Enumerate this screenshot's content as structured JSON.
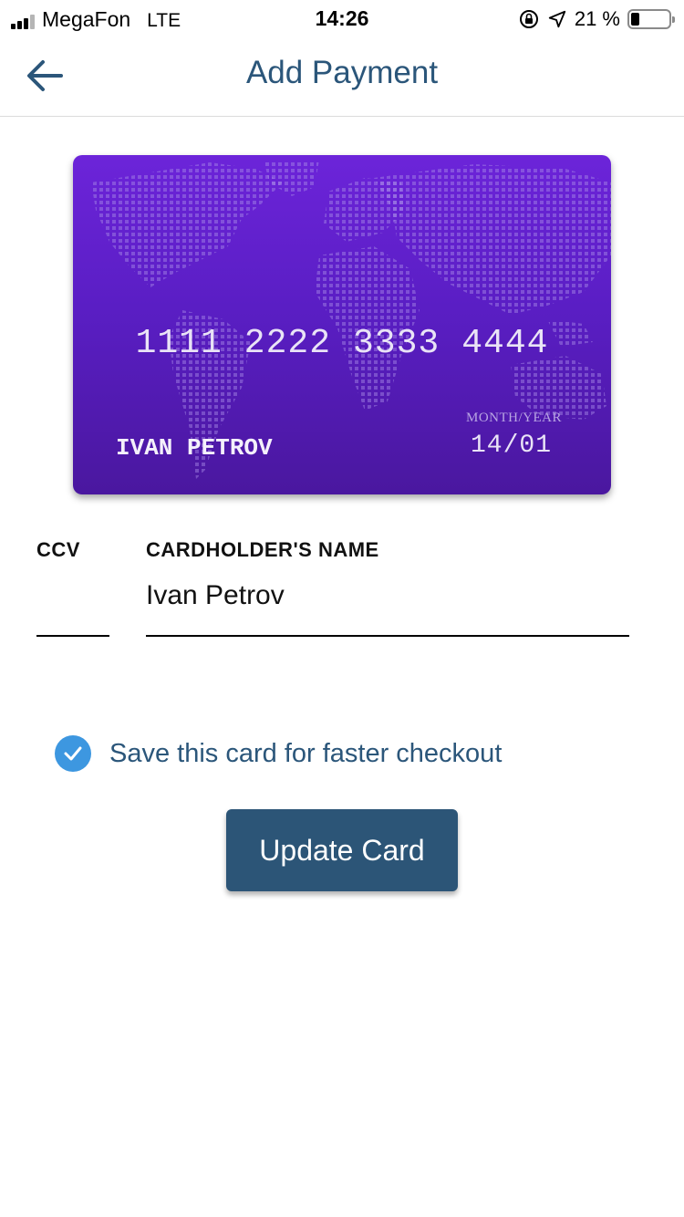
{
  "status_bar": {
    "carrier": "MegaFon",
    "network": "LTE",
    "time": "14:26",
    "battery": "21 %",
    "battery_level": 0.21
  },
  "header": {
    "title": "Add Payment",
    "back_icon": "arrow-left-icon"
  },
  "card": {
    "number_groups": [
      "1111",
      "2222",
      "3333",
      "4444"
    ],
    "holder": "IVAN PETROV",
    "expiry_label": "MONTH/YEAR",
    "expiry": "14/01",
    "colors": {
      "top": "#6c24d9",
      "bottom": "#4a179f"
    }
  },
  "form": {
    "ccv_label": "CCV",
    "ccv_value": "",
    "name_label": "CARDHOLDER'S NAME",
    "name_value": "Ivan Petrov"
  },
  "save_option": {
    "label": "Save this card for faster checkout",
    "checked": true,
    "icon": "check-circle-icon"
  },
  "update_button": {
    "label": "Update Card"
  },
  "colors": {
    "accent": "#2c5577",
    "title": "#2b567a",
    "check": "#3d97e0"
  }
}
